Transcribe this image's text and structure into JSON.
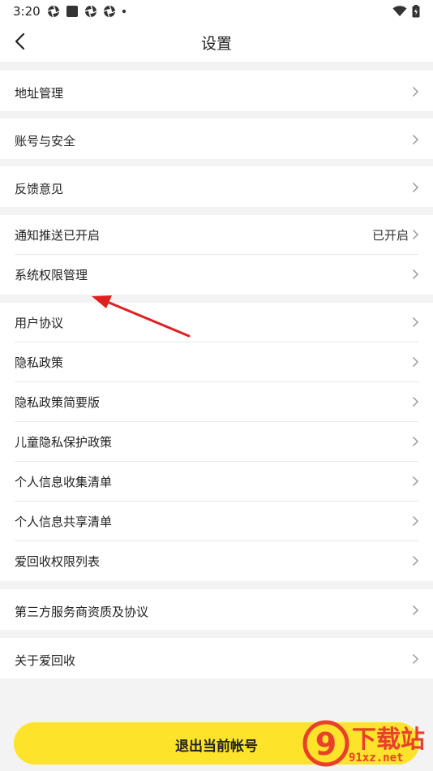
{
  "status_bar": {
    "time": "3:20",
    "icons": [
      "aperture-icon",
      "square-icon",
      "aperture-icon",
      "aperture-icon",
      "dot-icon"
    ],
    "right_icons": [
      "wifi-icon",
      "battery-icon"
    ]
  },
  "header": {
    "title": "设置",
    "back_icon": "chevron-left-icon"
  },
  "groups": [
    {
      "items": [
        {
          "label": "地址管理"
        }
      ]
    },
    {
      "items": [
        {
          "label": "账号与安全"
        }
      ]
    },
    {
      "items": [
        {
          "label": "反馈意见"
        }
      ]
    },
    {
      "items": [
        {
          "label": "通知推送已开启",
          "value": "已开启"
        },
        {
          "label": "系统权限管理"
        }
      ]
    },
    {
      "items": [
        {
          "label": "用户协议"
        },
        {
          "label": "隐私政策"
        },
        {
          "label": "隐私政策简要版"
        },
        {
          "label": "儿童隐私保护政策"
        },
        {
          "label": "个人信息收集清单"
        },
        {
          "label": "个人信息共享清单"
        },
        {
          "label": "爱回收权限列表"
        }
      ]
    },
    {
      "items": [
        {
          "label": "第三方服务商资质及协议"
        }
      ]
    },
    {
      "items": [
        {
          "label": "关于爱回收"
        }
      ]
    }
  ],
  "logout_button": {
    "label": "退出当前帐号"
  },
  "annotation": {
    "type": "red-arrow",
    "points_to": "系统权限管理",
    "color": "#e02020"
  },
  "watermark": {
    "big_text": "下载站",
    "small_text": "91xz.net",
    "logo_text": "9",
    "color": "#e8402a"
  },
  "colors": {
    "accent": "#fde42a",
    "background": "#f3f3f3",
    "chevron": "#9a9a9a"
  }
}
